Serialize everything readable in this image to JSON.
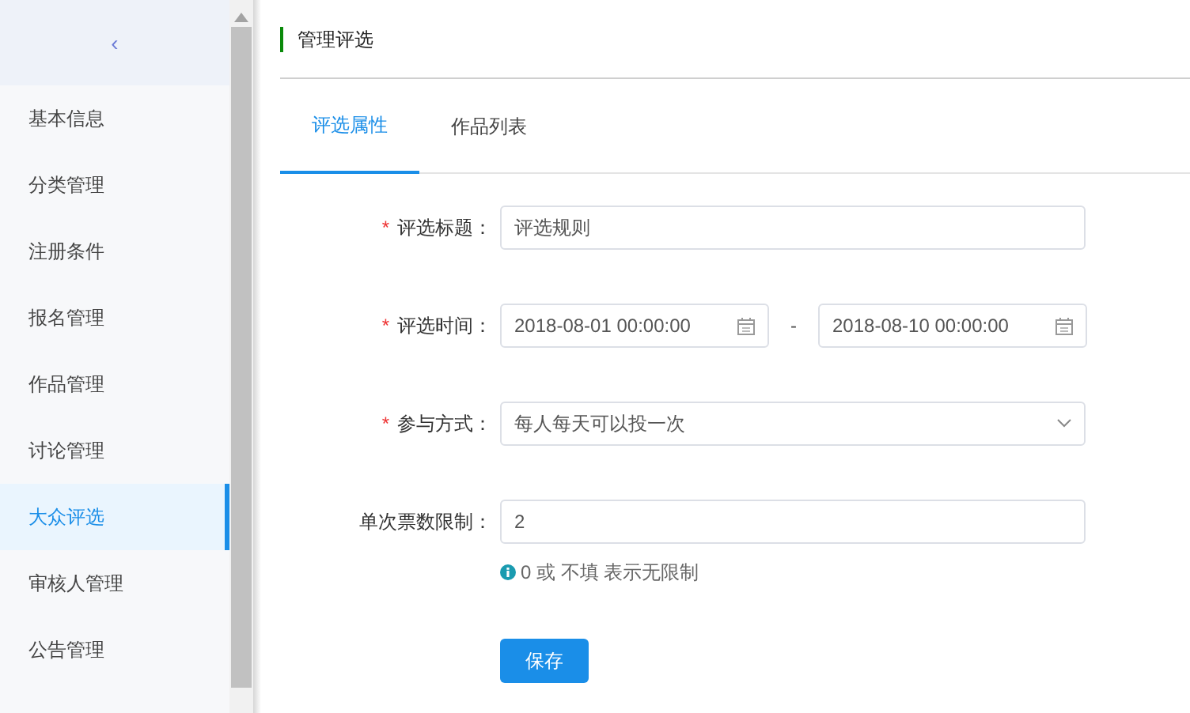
{
  "sidebar": {
    "toggle": "‹",
    "items": [
      {
        "label": "基本信息",
        "selected": false
      },
      {
        "label": "分类管理",
        "selected": false
      },
      {
        "label": "注册条件",
        "selected": false
      },
      {
        "label": "报名管理",
        "selected": false
      },
      {
        "label": "作品管理",
        "selected": false
      },
      {
        "label": "讨论管理",
        "selected": false
      },
      {
        "label": "大众评选",
        "selected": true
      },
      {
        "label": "审核人管理",
        "selected": false
      },
      {
        "label": "公告管理",
        "selected": false
      }
    ]
  },
  "header": {
    "title": "管理评选"
  },
  "tabs": [
    {
      "label": "评选属性",
      "selected": true
    },
    {
      "label": "作品列表",
      "selected": false
    }
  ],
  "form": {
    "required_mark": "*",
    "fields": [
      {
        "kind": "text",
        "label": "评选标题：",
        "required": true,
        "value": "评选规则"
      },
      {
        "kind": "daterange",
        "label": "评选时间：",
        "required": true,
        "start": "2018-08-01 00:00:00",
        "separator": "-",
        "end": "2018-08-10 00:00:00"
      },
      {
        "kind": "select",
        "label": "参与方式：",
        "required": true,
        "value": "每人每天可以投一次"
      },
      {
        "kind": "text",
        "label": "单次票数限制：",
        "required": false,
        "value": "2",
        "hint": "0 或 不填 表示无限制"
      }
    ],
    "save_button": "保存"
  }
}
